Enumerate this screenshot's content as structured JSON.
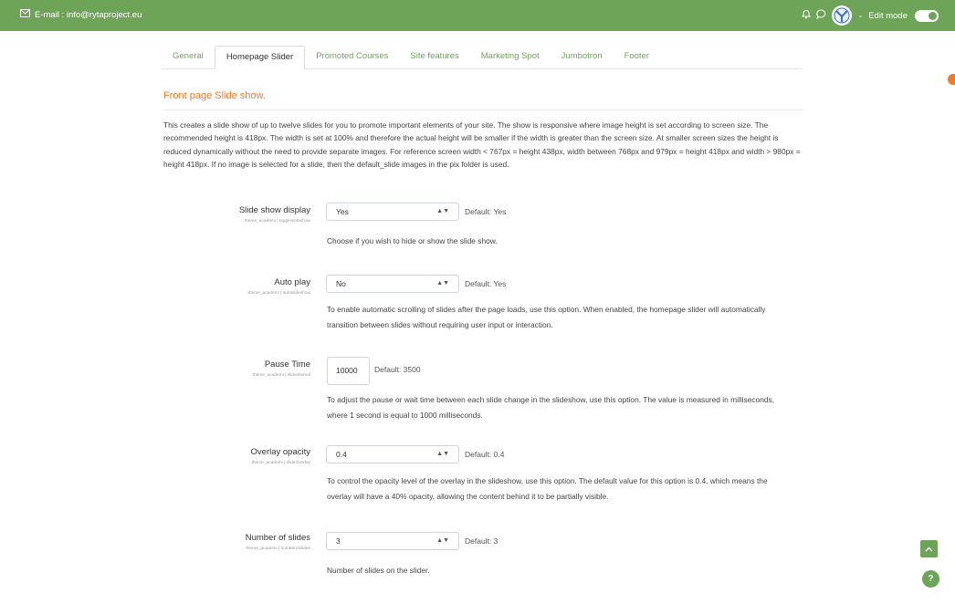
{
  "header": {
    "email": "E-mail : info@rytaproject.eu",
    "edit_mode_label": "Edit mode",
    "color": "#6ea458"
  },
  "tabs": [
    "General",
    "Homepage Slider",
    "Promoted Courses",
    "Site features",
    "Marketing Spot",
    "Jumbotron",
    "Footer"
  ],
  "active_tab": "Homepage Slider",
  "section": {
    "title": "Front page Slide show.",
    "intro": "This creates a slide show of up to twelve slides for you to promote important elements of your site. The show is responsive where image height is set according to screen size. The recommended height is 418px. The width is set at 100% and therefore the actual height will be smaller if the width is greater than the screen size. At smaller screen sizes the height is reduced dynamically without the need to provide separate images. For reference screen width < 767px = height 438px, width between 768px and 979px = height 418px and width > 980px = height 418px. If no image is selected for a slide, then the default_slide images in the pix folder is used."
  },
  "settings": [
    {
      "label": "Slide show display",
      "id": "theme_academi | toggleslideshow",
      "value": "Yes",
      "default": "Default: Yes",
      "description": "Choose if you wish to hide or show the slide show."
    },
    {
      "label": "Auto play",
      "id": "theme_academi | autoslideshow",
      "value": "No",
      "default": "Default: Yes",
      "description": "To enable automatic scrolling of slides after the page loads, use this option. When enabled, the homepage slider will automatically transition between slides without requiring user input or interaction."
    },
    {
      "label": "Pause Time",
      "id": "theme_academi | slideinterval",
      "value": "10000",
      "default": "Default: 3500",
      "description": "To adjust the pause or wait time between each slide change in the slideshow, use this option. The value is measured in milliseconds, where 1 second is equal to 1000 milliseconds."
    },
    {
      "label": "Overlay opacity",
      "id": "theme_academi | slideOverlay",
      "value": "0.4",
      "default": "Default: 0.4",
      "description": "To control the opacity level of the overlay in the slideshow, use this option. The default value for this option is 0.4, which means the overlay will have a 40% opacity, allowing the content behind it to be partially visible."
    },
    {
      "label": "Number of slides",
      "id": "theme_academi | numberofslides",
      "value": "3",
      "default": "Default: 3",
      "description": "Number of slides on the slider."
    }
  ],
  "floating": {
    "help": "?"
  }
}
